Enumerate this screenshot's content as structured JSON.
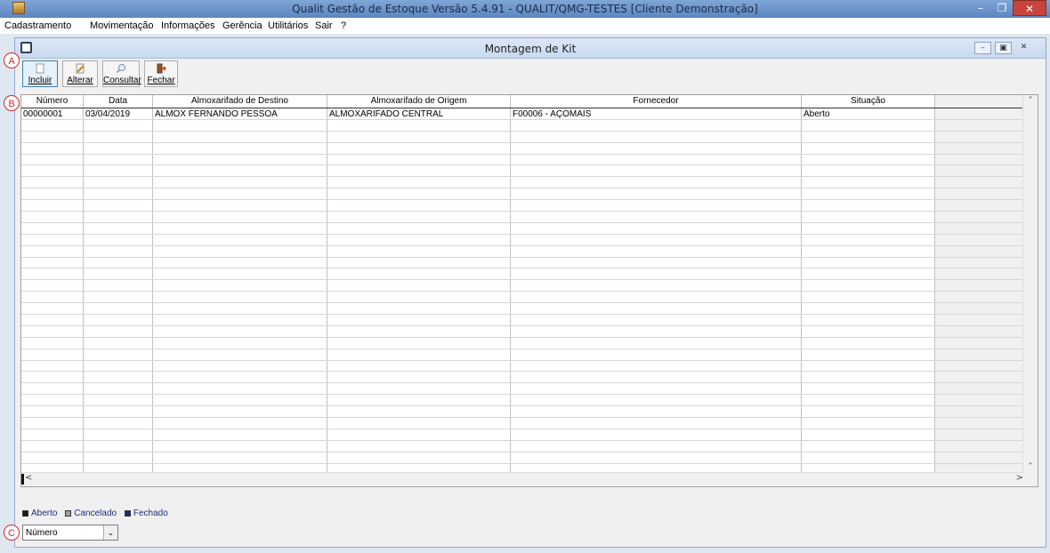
{
  "app": {
    "title": "Qualit Gestão de Estoque Versão 5.4.91 - QUALIT/QMG-TESTES [Cliente Demonstração]",
    "min_glyph": "–",
    "max_glyph": "❐",
    "close_glyph": "✕"
  },
  "menu": [
    "Cadastramento",
    "Movimentação",
    "Informações",
    "Gerência",
    "Utilitários",
    "Sair",
    "?"
  ],
  "window": {
    "title": "Montagem de Kit",
    "min_glyph": "–",
    "restore_glyph": "▣",
    "close_glyph": "✕"
  },
  "toolbar": {
    "incluir": "Incluir",
    "alterar": "Alterar",
    "consultar": "Consultar",
    "fechar": "Fechar"
  },
  "grid": {
    "columns": [
      "Número",
      "Data",
      "Almoxarifado de Destino",
      "Almoxarifado de Origem",
      "Fornecedor",
      "Situação",
      ""
    ],
    "rows": [
      [
        "00000001",
        "03/04/2019",
        "ALMOX FERNANDO PESSOA",
        "ALMOXARIFADO CENTRAL",
        "F00006 - AÇOMAIS",
        "Aberto",
        ""
      ]
    ],
    "scroll_up": "˄",
    "scroll_down": "˅",
    "scroll_left": "<",
    "scroll_right": ">"
  },
  "legend": [
    {
      "label": "Aberto",
      "color": "#1a1a1a"
    },
    {
      "label": "Cancelado",
      "color": "#9e9e9e"
    },
    {
      "label": "Fechado",
      "color": "#1b2f7a"
    }
  ],
  "sort_select": {
    "value": "Número",
    "arrow": "⌄"
  },
  "markers": [
    "A",
    "B",
    "C"
  ]
}
